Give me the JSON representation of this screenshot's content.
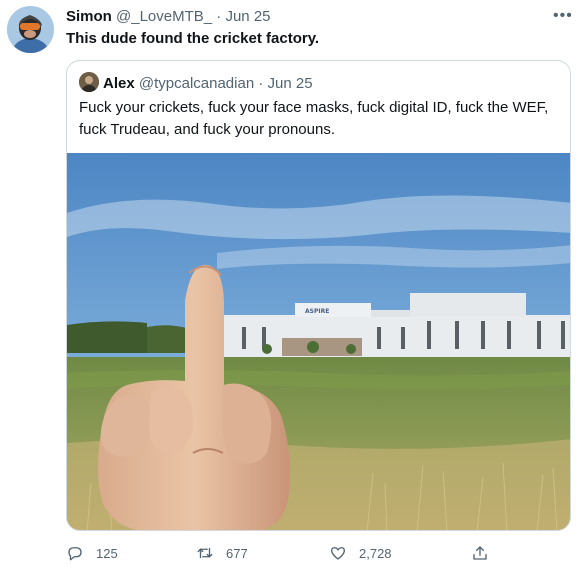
{
  "tweet": {
    "author_name": "Simon",
    "author_handle": "@_LoveMTB_",
    "separator": "·",
    "date": "Jun 25",
    "text": "This dude found the cricket factory.",
    "more_label": "•••"
  },
  "quoted_tweet": {
    "author_name": "Alex",
    "author_handle": "@typcalcanadian",
    "separator": "·",
    "date": "Jun 25",
    "text": "Fuck your crickets, fuck your face masks, fuck digital ID, fuck the WEF, fuck Trudeau, and fuck your pronouns.",
    "image": {
      "building_sign": "ASPIRE"
    }
  },
  "actions": {
    "reply_count": "125",
    "retweet_count": "677",
    "like_count": "2,728"
  },
  "icons": {
    "reply": "reply-icon",
    "retweet": "retweet-icon",
    "like": "heart-icon",
    "share": "share-icon",
    "more": "more-icon"
  },
  "colors": {
    "text": "#0f1419",
    "muted": "#536471",
    "border": "#cfd9de"
  }
}
